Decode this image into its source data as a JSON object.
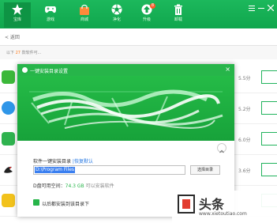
{
  "nav": {
    "items": [
      {
        "label": "宝库",
        "icon": "star-icon"
      },
      {
        "label": "游戏",
        "icon": "gamepad-icon"
      },
      {
        "label": "商城",
        "icon": "shopping-bag-icon"
      },
      {
        "label": "净化",
        "icon": "aperture-icon"
      },
      {
        "label": "升级",
        "icon": "upgrade-arrow-icon",
        "badge": "8"
      },
      {
        "label": "卸载",
        "icon": "trash-icon"
      }
    ],
    "window_icons": [
      "menu-icon",
      "minimize-icon",
      "close-icon"
    ]
  },
  "back": {
    "label": "< 返回"
  },
  "list": {
    "count_prefix": "以下",
    "count_num": "27",
    "count_suffix": "款软件可..."
  },
  "apps": [
    {
      "size": "5.5分",
      "icon": "chat-app-icon",
      "icon_color": "#3cb83a"
    },
    {
      "size": "5.2分",
      "icon": "message-app-icon",
      "icon_color": "#2f96e8"
    },
    {
      "size": "6.0分",
      "icon": "contact-app-icon",
      "icon_color": "#2fb34f"
    },
    {
      "size": "3.6分",
      "icon": "bird-app-icon",
      "icon_color": "#222222"
    },
    {
      "size": "",
      "icon": "yellow-app-icon",
      "icon_color": "#f2c21c"
    }
  ],
  "dialog": {
    "title": "一键安装目录设置",
    "close": "×",
    "dir_label": "软件一键安装目录 ",
    "dir_link": "|恢复默认",
    "dir_value": "D:\\Program Files",
    "browse_button": "选择目录",
    "space_prefix": "D盘可用空间：",
    "space_value": "74.3 GB",
    "space_note": " 可以安装软件",
    "remember_label": "以后都安装到该目录下"
  },
  "watermark": {
    "title": "头条",
    "url": "www.xietoutiao.com"
  },
  "colors": {
    "brand": "#1cb85c",
    "dialog_header": "#27b54a",
    "selection": "#3a7ff0",
    "accent_orange": "#ff7a1a"
  }
}
